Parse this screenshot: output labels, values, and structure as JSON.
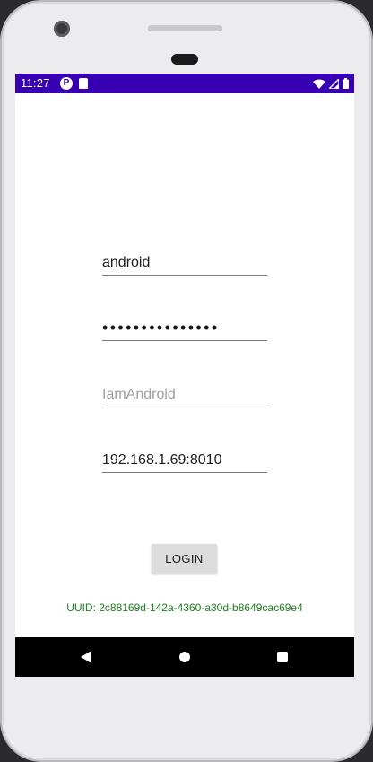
{
  "status_bar": {
    "time": "11:27",
    "icons": [
      "notification-app-icon",
      "sd-card-icon",
      "wifi-icon",
      "cell-signal-icon",
      "battery-icon"
    ],
    "color": "#3700b3"
  },
  "form": {
    "username_value": "android",
    "password_value": "•••••••••••••••",
    "name_placeholder": "IamAndroid",
    "server_value": "192.168.1.69:8010"
  },
  "login_button": {
    "label": "LOGIN"
  },
  "uuid_label": "UUID: 2c88169d-142a-4360-a30d-b8649cac69e4",
  "nav_bar": {
    "icons": [
      "back-icon",
      "home-icon",
      "recents-icon"
    ]
  }
}
